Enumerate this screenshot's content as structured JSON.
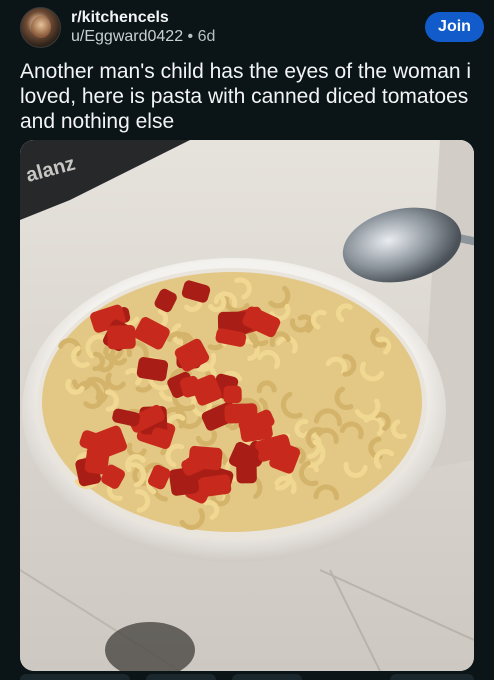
{
  "post": {
    "subreddit": "r/kitchencels",
    "username": "u/Eggward0422",
    "separator": "•",
    "age": "6d",
    "join_label": "Join",
    "title": "Another man's child has the eyes of the woman i loved, here is pasta with canned diced tomatoes and nothing else"
  },
  "image": {
    "subject": "pasta-bowl-photo",
    "brand_text": "alanz"
  },
  "colors": {
    "background": "#0b1416",
    "join_button": "#115bca",
    "text_primary": "#f2f4f5",
    "text_secondary": "#b7c0c4"
  }
}
